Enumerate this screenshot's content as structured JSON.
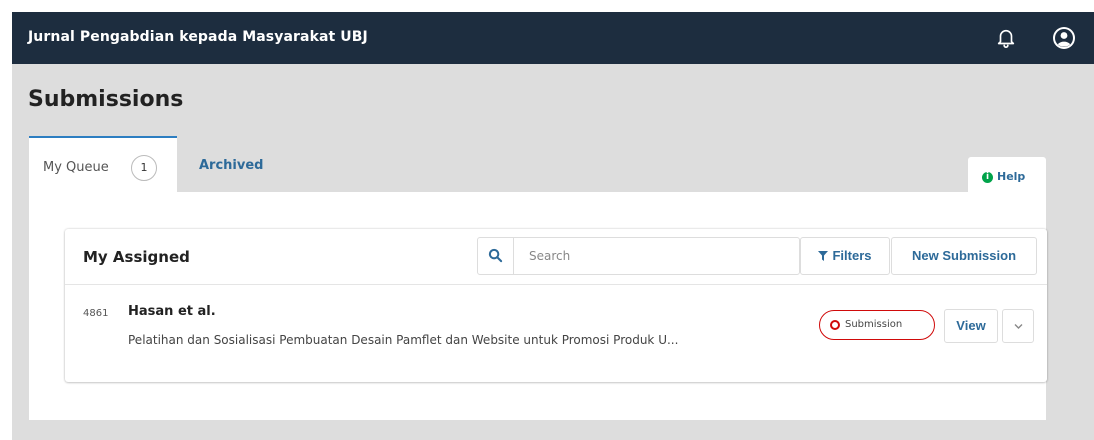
{
  "app": {
    "title": "Jurnal Pengabdian kepada Masyarakat UBJ"
  },
  "page": {
    "title": "Submissions"
  },
  "tabs": [
    {
      "label": "My Queue",
      "count": "1",
      "active": true
    },
    {
      "label": "Archived",
      "active": false
    }
  ],
  "help": {
    "label": "Help"
  },
  "list": {
    "title": "My Assigned",
    "search": {
      "placeholder": "Search",
      "value": ""
    },
    "filters_label": "Filters",
    "new_submission_label": "New Submission",
    "items": [
      {
        "id": "4861",
        "authors": "Hasan et al.",
        "title": "Pelatihan dan Sosialisasi Pembuatan Desain Pamflet dan Website untuk Promosi Produk U...",
        "stage": "Submission",
        "view_label": "View"
      }
    ]
  },
  "colors": {
    "topbar": "#1d2d3f",
    "accent": "#2d6a99",
    "tab_active_border": "#2d7ec1",
    "stage_badge": "#d00a0a",
    "help_icon": "#00a34a",
    "background": "#dddddd"
  },
  "icons": {
    "notifications": "bell-icon",
    "user": "user-icon",
    "search": "search-icon",
    "filters": "funnel-icon",
    "help": "info-icon",
    "expand": "chevron-down-icon"
  }
}
